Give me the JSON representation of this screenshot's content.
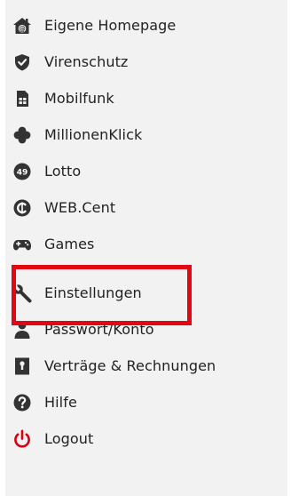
{
  "colors": {
    "panel_bg": "#f2f2f2",
    "icon": "#333333",
    "logout_icon": "#d7000f",
    "highlight": "#e30613",
    "text": "#222222"
  },
  "menu": {
    "items": [
      {
        "label": "Eigene Homepage",
        "icon": "homepage-icon"
      },
      {
        "label": "Virenschutz",
        "icon": "shield-icon"
      },
      {
        "label": "Mobilfunk",
        "icon": "sim-card-icon"
      },
      {
        "label": "MillionenKlick",
        "icon": "clover-icon"
      },
      {
        "label": "Lotto",
        "icon": "lotto-ball-icon",
        "icon_text": "49"
      },
      {
        "label": "WEB.Cent",
        "icon": "webcent-coin-icon"
      },
      {
        "label": "Games",
        "icon": "gamepad-icon"
      },
      {
        "label": "Einstellungen",
        "icon": "wrench-icon",
        "highlighted": true
      },
      {
        "label": "Passwort/Konto",
        "icon": "user-icon"
      },
      {
        "label": "Verträge & Rechnungen",
        "icon": "contract-lock-icon"
      },
      {
        "label": "Hilfe",
        "icon": "help-icon"
      },
      {
        "label": "Logout",
        "icon": "power-icon"
      }
    ]
  }
}
